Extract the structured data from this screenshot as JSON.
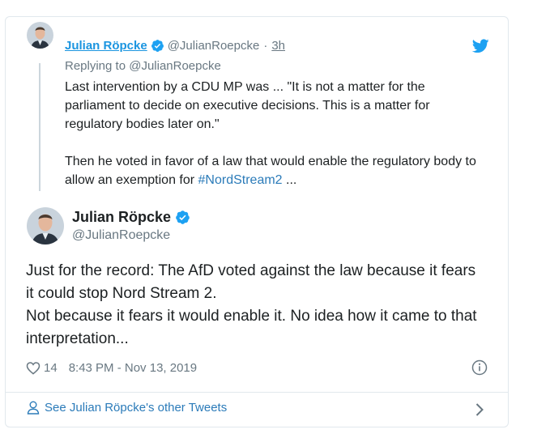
{
  "parent_tweet": {
    "author_name": "Julian Röpcke",
    "handle": "@JulianRoepcke",
    "separator": "·",
    "time": "3h",
    "replying_to": "Replying to @JulianRoepcke",
    "text_p1": "Last intervention by a CDU MP was ... \"It is not a matter for the parliament to decide on executive decisions. This is a matter for regulatory bodies later on.\"",
    "text_p2_before": "Then he voted in favor of a law that would enable the regulatory body to allow an exemption for ",
    "hashtag": "#NordStream2",
    "text_p2_after": " ..."
  },
  "main_tweet": {
    "author_name": "Julian Röpcke",
    "handle": "@JulianRoepcke",
    "line1": "Just for the record: The AfD voted against the law because it fears it could stop Nord Stream 2.",
    "line2": "Not because it fears it would enable it. No idea how it came to that interpretation...",
    "likes": "14",
    "timestamp": "8:43 PM - Nov 13, 2019"
  },
  "footer": {
    "link_text": "See Julian Röpcke's other Tweets"
  },
  "icons": {
    "verified": "verified-badge-icon",
    "brand": "twitter-bird-icon",
    "like": "heart-icon",
    "info": "info-icon",
    "person": "person-icon",
    "chevron": "chevron-right-icon"
  },
  "colors": {
    "link_blue": "#2b7bb9",
    "twitter_blue": "#1da1f2",
    "grey_text": "#697882",
    "border": "#e1e8ed"
  }
}
